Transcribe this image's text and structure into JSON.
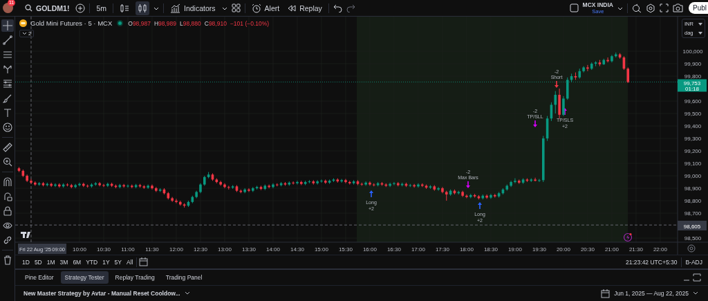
{
  "account": {
    "notification_count": "11"
  },
  "toolbar": {
    "symbol": "GOLDM1!",
    "interval": "5m",
    "chart_styles": [
      {
        "selected": false
      },
      {
        "selected": true
      }
    ],
    "indicators": "Indicators",
    "alert": "Alert",
    "replay": "Replay",
    "exchange": "MCX INDIA",
    "exchange_status": "Save",
    "publish": "Publ"
  },
  "drawing_tools": [
    {
      "selected": true
    },
    {
      "selected": false
    },
    {
      "selected": false
    },
    {
      "selected": false
    },
    {
      "selected": false
    },
    {
      "selected": false
    },
    {
      "selected": false
    },
    {
      "selected": false
    },
    {
      "selected": false
    },
    {
      "selected": false
    },
    {
      "selected": false
    },
    {
      "selected": false
    },
    {
      "selected": false
    },
    {
      "selected": false
    },
    {
      "selected": false
    },
    {
      "selected": false
    }
  ],
  "legend": {
    "title": "Gold Mini Futures · 5 · MCX",
    "ohlc": [
      {
        "key": "O",
        "value": "98,987"
      },
      {
        "key": "H",
        "value": "98,989"
      },
      {
        "key": "L",
        "value": "98,880"
      },
      {
        "key": "C",
        "value": "98,910"
      }
    ],
    "change": "−101 (−0.10%)",
    "collapsed_count": "2"
  },
  "price_scale": {
    "currency": "INR",
    "unit": "dag",
    "last_price": "99,753",
    "countdown": "01:18",
    "crosshair_price": "98,605"
  },
  "chart_data": {
    "type": "candlestick",
    "grid": true,
    "ylim": [
      98467,
      100278
    ],
    "ref_lines": [
      {
        "axis": "y",
        "value": 99753,
        "color": "#089981"
      },
      {
        "axis": "y",
        "value": 98605,
        "color": "#787b86"
      }
    ],
    "categories": [
      null,
      null,
      null,
      null,
      null,
      null,
      null,
      null,
      null,
      null,
      null,
      null,
      null,
      null,
      null,
      "10:00",
      null,
      null,
      null,
      null,
      null,
      "10:30",
      null,
      null,
      null,
      null,
      null,
      "11:00",
      null,
      null,
      null,
      null,
      null,
      "11:30",
      null,
      null,
      null,
      null,
      null,
      "12:00",
      null,
      null,
      null,
      null,
      null,
      "12:30",
      null,
      null,
      null,
      null,
      null,
      "13:00",
      null,
      null,
      null,
      null,
      null,
      "13:30",
      null,
      null,
      null,
      null,
      null,
      "14:00",
      null,
      null,
      null,
      null,
      null,
      "14:30",
      null,
      null,
      null,
      null,
      null,
      "15:00",
      null,
      null,
      null,
      null,
      null,
      "15:30",
      null,
      null,
      null,
      null,
      null,
      "16:00",
      null,
      null,
      null,
      null,
      null,
      "16:30",
      null,
      null,
      null,
      null,
      null,
      "17:00",
      null,
      null,
      null,
      null,
      null,
      "17:30",
      null,
      null,
      null,
      null,
      null,
      "18:00",
      null,
      null,
      null,
      null,
      null,
      "18:30",
      null,
      null,
      null,
      null,
      null,
      "19:00",
      null,
      null,
      null,
      null,
      null,
      "19:30",
      null,
      null,
      null,
      null,
      null,
      "20:00",
      null,
      null,
      null,
      null,
      null,
      "20:30",
      null,
      null,
      null,
      null,
      null,
      "21:00",
      null,
      null,
      null,
      null,
      null,
      "21:30",
      null,
      null,
      null,
      null,
      null,
      "22:00"
    ],
    "ohlc": [
      [
        99060,
        99070,
        99030,
        99040
      ],
      [
        99040,
        99050,
        98990,
        99000
      ],
      [
        99000,
        99010,
        98950,
        98960
      ],
      [
        98960,
        98975,
        98935,
        98945
      ],
      [
        98945,
        98955,
        98920,
        98930
      ],
      [
        98930,
        98950,
        98920,
        98940
      ],
      [
        98940,
        98950,
        98915,
        98925
      ],
      [
        98925,
        98945,
        98915,
        98935
      ],
      [
        98935,
        98945,
        98910,
        98920
      ],
      [
        98920,
        98940,
        98910,
        98930
      ],
      [
        98930,
        98940,
        98905,
        98915
      ],
      [
        98915,
        98940,
        98905,
        98930
      ],
      [
        98930,
        98940,
        98915,
        98925
      ],
      [
        98925,
        98935,
        98900,
        98910
      ],
      [
        98910,
        98935,
        98900,
        98925
      ],
      [
        98925,
        98945,
        98915,
        98935
      ],
      [
        98935,
        98945,
        98910,
        98920
      ],
      [
        98920,
        98930,
        98905,
        98915
      ],
      [
        98915,
        98940,
        98905,
        98930
      ],
      [
        98930,
        98950,
        98920,
        98940
      ],
      [
        98940,
        98950,
        98915,
        98925
      ],
      [
        98925,
        98935,
        98910,
        98920
      ],
      [
        98920,
        98945,
        98910,
        98935
      ],
      [
        98935,
        98945,
        98910,
        98920
      ],
      [
        98920,
        98930,
        98900,
        98910
      ],
      [
        98910,
        98935,
        98900,
        98925
      ],
      [
        98925,
        98935,
        98905,
        98915
      ],
      [
        98915,
        98930,
        98905,
        98920
      ],
      [
        98920,
        98930,
        98900,
        98910
      ],
      [
        98910,
        98935,
        98900,
        98925
      ],
      [
        98925,
        98935,
        98905,
        98915
      ],
      [
        98915,
        98925,
        98895,
        98905
      ],
      [
        98905,
        98930,
        98895,
        98920
      ],
      [
        98920,
        98930,
        98890,
        98900
      ],
      [
        98900,
        98910,
        98870,
        98880
      ],
      [
        98880,
        98900,
        98870,
        98890
      ],
      [
        98890,
        98900,
        98850,
        98860
      ],
      [
        98860,
        98870,
        98810,
        98820
      ],
      [
        98820,
        98830,
        98790,
        98800
      ],
      [
        98800,
        98815,
        98780,
        98790
      ],
      [
        98790,
        98800,
        98760,
        98770
      ],
      [
        98770,
        98780,
        98745,
        98760
      ],
      [
        98760,
        98800,
        98750,
        98790
      ],
      [
        98790,
        98840,
        98780,
        98830
      ],
      [
        98830,
        98880,
        98820,
        98870
      ],
      [
        98870,
        98940,
        98860,
        98930
      ],
      [
        98930,
        99000,
        98920,
        98990
      ],
      [
        98990,
        99030,
        98980,
        99010
      ],
      [
        99010,
        99020,
        98960,
        98970
      ],
      [
        98970,
        98980,
        98940,
        98950
      ],
      [
        98950,
        98960,
        98920,
        98930
      ],
      [
        98930,
        98940,
        98900,
        98910
      ],
      [
        98910,
        98920,
        98890,
        98905
      ],
      [
        98905,
        98925,
        98895,
        98915
      ],
      [
        98915,
        98925,
        98870,
        98880
      ],
      [
        98880,
        98890,
        98860,
        98870
      ],
      [
        98870,
        98900,
        98860,
        98890
      ],
      [
        98890,
        98900,
        98870,
        98880
      ],
      [
        98880,
        98910,
        98870,
        98900
      ],
      [
        98900,
        98920,
        98890,
        98910
      ],
      [
        98910,
        98920,
        98885,
        98895
      ],
      [
        98895,
        98930,
        98885,
        98920
      ],
      [
        98920,
        98930,
        98900,
        98910
      ],
      [
        98910,
        98940,
        98900,
        98930
      ],
      [
        98930,
        98940,
        98915,
        98925
      ],
      [
        98925,
        98950,
        98915,
        98940
      ],
      [
        98940,
        98950,
        98920,
        98930
      ],
      [
        98930,
        98955,
        98920,
        98945
      ],
      [
        98945,
        98955,
        98930,
        98940
      ],
      [
        98940,
        98960,
        98930,
        98950
      ],
      [
        98950,
        98960,
        98925,
        98935
      ],
      [
        98935,
        98960,
        98925,
        98950
      ],
      [
        98950,
        98965,
        98940,
        98955
      ],
      [
        98955,
        98965,
        98930,
        98940
      ],
      [
        98940,
        98965,
        98930,
        98955
      ],
      [
        98955,
        98970,
        98945,
        98960
      ],
      [
        98960,
        98970,
        98935,
        98945
      ],
      [
        98945,
        98970,
        98935,
        98960
      ],
      [
        98960,
        98980,
        98950,
        98970
      ],
      [
        98970,
        98980,
        98945,
        98955
      ],
      [
        98955,
        98975,
        98945,
        98965
      ],
      [
        98965,
        98975,
        98940,
        98950
      ],
      [
        98950,
        98960,
        98930,
        98940
      ],
      [
        98940,
        98965,
        98930,
        98955
      ],
      [
        98955,
        98965,
        98925,
        98935
      ],
      [
        98935,
        98945,
        98920,
        98930
      ],
      [
        98930,
        98955,
        98920,
        98945
      ],
      [
        98945,
        98955,
        98920,
        98930
      ],
      [
        98930,
        98940,
        98915,
        98925
      ],
      [
        98925,
        98950,
        98915,
        98940
      ],
      [
        98940,
        98950,
        98920,
        98930
      ],
      [
        98930,
        98940,
        98910,
        98920
      ],
      [
        98920,
        98945,
        98910,
        98935
      ],
      [
        98935,
        98950,
        98925,
        98940
      ],
      [
        98940,
        98950,
        98915,
        98925
      ],
      [
        98925,
        98945,
        98915,
        98935
      ],
      [
        98935,
        98945,
        98910,
        98920
      ],
      [
        98920,
        98935,
        98910,
        98925
      ],
      [
        98925,
        98935,
        98905,
        98915
      ],
      [
        98915,
        98940,
        98905,
        98930
      ],
      [
        98930,
        98940,
        98910,
        98920
      ],
      [
        98920,
        98930,
        98895,
        98905
      ],
      [
        98905,
        98925,
        98895,
        98915
      ],
      [
        98915,
        98925,
        98880,
        98890
      ],
      [
        98890,
        98910,
        98880,
        98900
      ],
      [
        98900,
        98910,
        98860,
        98870
      ],
      [
        98870,
        98880,
        98800,
        98850
      ],
      [
        98850,
        98890,
        98840,
        98880
      ],
      [
        98880,
        98890,
        98850,
        98860
      ],
      [
        98860,
        98880,
        98850,
        98870
      ],
      [
        98870,
        98880,
        98830,
        98840
      ],
      [
        98840,
        98850,
        98820,
        98830
      ],
      [
        98830,
        98855,
        98820,
        98845
      ],
      [
        98845,
        98855,
        98825,
        98835
      ],
      [
        98835,
        98845,
        98810,
        98820
      ],
      [
        98820,
        98850,
        98810,
        98840
      ],
      [
        98840,
        98850,
        98815,
        98825
      ],
      [
        98825,
        98855,
        98815,
        98845
      ],
      [
        98845,
        98855,
        98825,
        98835
      ],
      [
        98835,
        98870,
        98825,
        98860
      ],
      [
        98860,
        98900,
        98850,
        98890
      ],
      [
        98890,
        98930,
        98880,
        98920
      ],
      [
        98920,
        98960,
        98910,
        98950
      ],
      [
        98950,
        98980,
        98940,
        98960
      ],
      [
        98960,
        98970,
        98935,
        98945
      ],
      [
        98945,
        98980,
        98935,
        98970
      ],
      [
        98970,
        98980,
        98950,
        98960
      ],
      [
        98960,
        98980,
        98950,
        98970
      ],
      [
        98970,
        98985,
        98955,
        98960
      ],
      [
        98960,
        98975,
        98950,
        98965
      ],
      [
        98965,
        99320,
        98950,
        99300
      ],
      [
        99300,
        99480,
        99280,
        99460
      ],
      [
        99460,
        99590,
        99440,
        99570
      ],
      [
        99570,
        99680,
        99500,
        99650
      ],
      [
        99650,
        99700,
        99460,
        99490
      ],
      [
        99490,
        99640,
        99480,
        99620
      ],
      [
        99620,
        99790,
        99610,
        99770
      ],
      [
        99770,
        99820,
        99750,
        99800
      ],
      [
        99800,
        99830,
        99770,
        99790
      ],
      [
        99790,
        99860,
        99780,
        99840
      ],
      [
        99840,
        99880,
        99830,
        99870
      ],
      [
        99870,
        99890,
        99840,
        99860
      ],
      [
        99860,
        99910,
        99850,
        99900
      ],
      [
        99900,
        99920,
        99880,
        99910
      ],
      [
        99910,
        99930,
        99880,
        99895
      ],
      [
        99895,
        99940,
        99890,
        99930
      ],
      [
        99930,
        99950,
        99910,
        99920
      ],
      [
        99920,
        99970,
        99910,
        99960
      ],
      [
        99960,
        99990,
        99950,
        99975
      ],
      [
        99975,
        99985,
        99940,
        99950
      ],
      [
        99950,
        99960,
        99850,
        99860
      ],
      [
        99860,
        99870,
        99745,
        99753
      ],
      null,
      null,
      null,
      null,
      null,
      null,
      null,
      null
    ],
    "yticks": [
      {
        "value": 100000,
        "label": "100,000"
      },
      {
        "value": 99900,
        "label": "99,900"
      },
      {
        "value": 99800,
        "label": "99,800"
      },
      {
        "value": 99600,
        "label": "99,600"
      },
      {
        "value": 99500,
        "label": "99,500"
      },
      {
        "value": 99400,
        "label": "99,400"
      },
      {
        "value": 99300,
        "label": "99,300"
      },
      {
        "value": 99200,
        "label": "99,200"
      },
      {
        "value": 99100,
        "label": "99,100"
      },
      {
        "value": 99000,
        "label": "99,000"
      },
      {
        "value": 98900,
        "label": "98,900"
      },
      {
        "value": 98800,
        "label": "98,800"
      },
      {
        "value": 98700,
        "label": "98,700"
      },
      {
        "value": 98500,
        "label": "98,500"
      }
    ]
  },
  "trades": [
    {
      "kind": "buy_entry",
      "label": "Long",
      "quantity": "+2"
    },
    {
      "kind": "sell_exit",
      "label": "Max Bars",
      "quantity": "-2"
    },
    {
      "kind": "buy_entry",
      "label": "Long",
      "quantity": "+2"
    },
    {
      "kind": "sell_exit",
      "label": "TP/SLL",
      "quantity": "-2"
    },
    {
      "kind": "sell_entry",
      "label": "Short",
      "quantity": "-2"
    },
    {
      "kind": "buy_exit",
      "label": "TP/SLS",
      "quantity": "+2"
    }
  ],
  "time_scale": {
    "crosshair_date": "Fri 22 Aug '25",
    "crosshair_time": "09:00"
  },
  "ranges": [
    {
      "label": "1D"
    },
    {
      "label": "5D"
    },
    {
      "label": "1M"
    },
    {
      "label": "3M"
    },
    {
      "label": "6M"
    },
    {
      "label": "YTD"
    },
    {
      "label": "1Y"
    },
    {
      "label": "5Y"
    },
    {
      "label": "All"
    }
  ],
  "clock": "21:23:42 UTC+5:30",
  "adjustment": "B-ADJ",
  "panel_tabs": [
    {
      "label": "Pine Editor",
      "selected": false
    },
    {
      "label": "Strategy Tester",
      "selected": true
    },
    {
      "label": "Replay Trading",
      "selected": false
    },
    {
      "label": "Trading Panel",
      "selected": false
    }
  ],
  "strategy": {
    "name": "New Master Strategy by Avtar - Manual Reset Cooldow...",
    "date_range": "Jun 1, 2025 — Aug 22, 2025"
  }
}
